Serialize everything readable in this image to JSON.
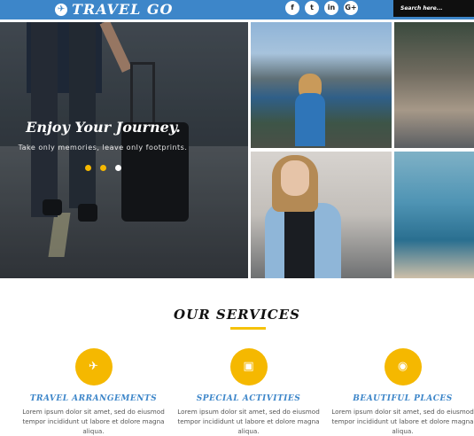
{
  "header": {
    "logo_text": "TRAVEL GO",
    "social": [
      "f",
      "t",
      "in",
      "G+"
    ],
    "search_placeholder": "Search here..."
  },
  "slider": {
    "title": "Enjoy Your Journey.",
    "subtitle": "Take only memories, leave only footprints.",
    "dots": 3,
    "active_dot": 3
  },
  "services": {
    "title": "OUR SERVICES",
    "items": [
      {
        "icon": "plane-icon",
        "title": "TRAVEL ARRANGEMENTS",
        "text": "Lorem ipsum dolor sit amet, sed do eiusmod tempor incididunt ut labore et dolore magna aliqua."
      },
      {
        "icon": "briefcase-icon",
        "title": "SPECIAL ACTIVITIES",
        "text": "Lorem ipsum dolor sit amet, sed do eiusmod tempor incididunt ut labore et dolore magna aliqua."
      },
      {
        "icon": "globe-icon",
        "title": "BEAUTIFUL PLACES",
        "text": "Lorem ipsum dolor sit amet, sed do eiusmod tempor incididunt ut labore et dolore magna aliqua."
      }
    ]
  },
  "colors": {
    "brand_blue": "#3d86c9",
    "accent_yellow": "#f5b800"
  }
}
